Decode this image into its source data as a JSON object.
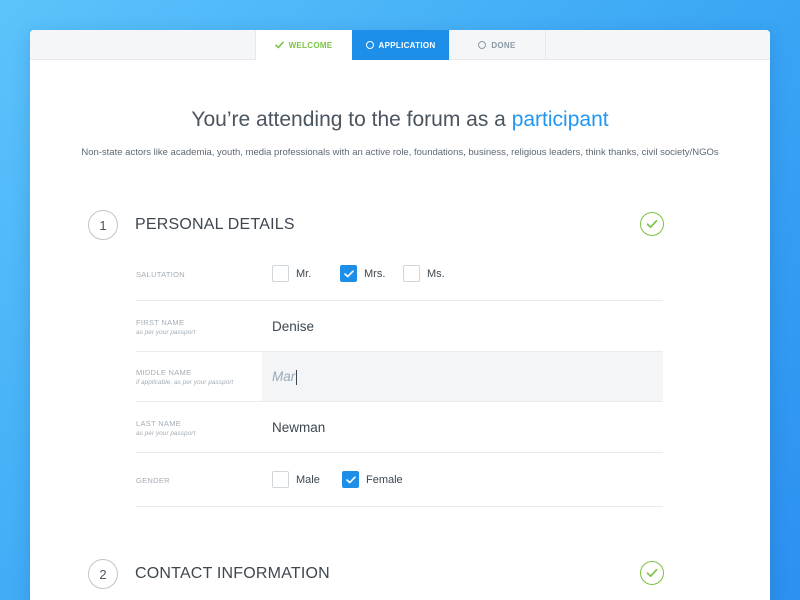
{
  "steps": [
    {
      "label": "Welcome",
      "state": "done",
      "icon": "check-icon"
    },
    {
      "label": "Application",
      "state": "active",
      "icon": "circle-icon"
    },
    {
      "label": "Done",
      "state": "pending",
      "icon": "circle-icon"
    }
  ],
  "header": {
    "title_prefix": "You’re attending to the forum as a",
    "title_accent": "participant",
    "subtitle": "Non-state actors like academia, youth, media professionals with an active role, foundations, business, religious leaders, think thanks, civil society/NGOs"
  },
  "sections": [
    {
      "number": "1",
      "title": "PERSONAL DETAILS",
      "complete": true
    },
    {
      "number": "2",
      "title": "CONTACT INFORMATION",
      "complete": true
    }
  ],
  "form": {
    "salutation": {
      "label": "Salutation",
      "options": [
        {
          "label": "Mr.",
          "checked": false
        },
        {
          "label": "Mrs.",
          "checked": true
        },
        {
          "label": "Ms.",
          "checked": false
        }
      ]
    },
    "first_name": {
      "label": "First name",
      "hint": "as per your passport",
      "value": "Denise"
    },
    "middle_name": {
      "label": "Middle name",
      "hint": "if applicable, as per your passport",
      "value": "Mar"
    },
    "last_name": {
      "label": "Last name",
      "hint": "as per your passport",
      "value": "Newman"
    },
    "gender": {
      "label": "Gender",
      "options": [
        {
          "label": "Male",
          "checked": false
        },
        {
          "label": "Female",
          "checked": true
        }
      ]
    }
  },
  "colors": {
    "accent": "#1e8fe8",
    "success": "#7cc242",
    "background_gradient_start": "#5cc3fb",
    "background_gradient_end": "#2c90f0"
  }
}
